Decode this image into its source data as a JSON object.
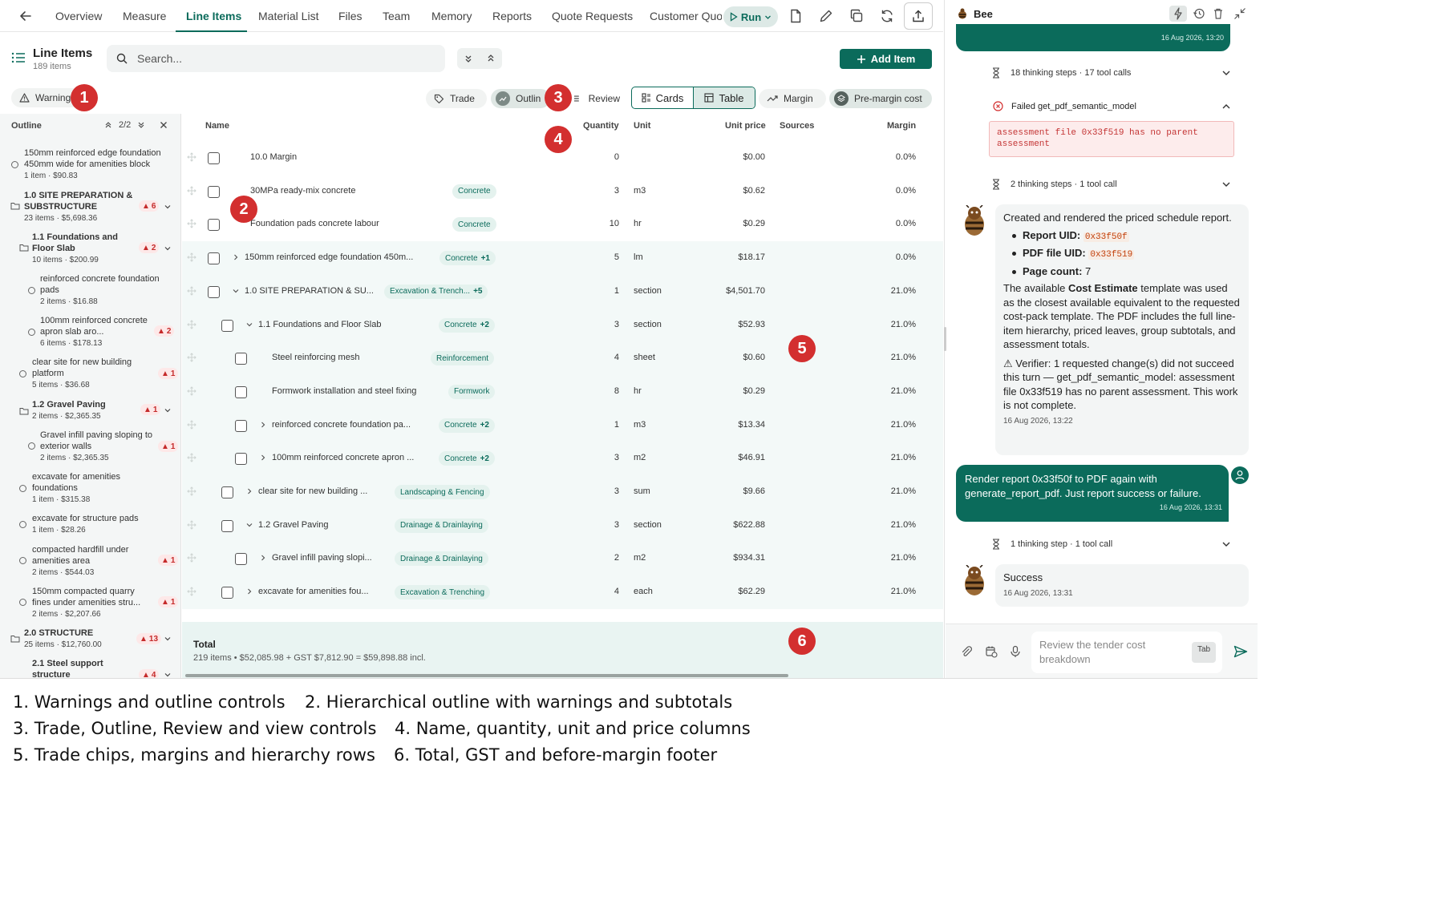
{
  "nav": {
    "tabs": [
      {
        "label": "Overview",
        "active": false
      },
      {
        "label": "Measure",
        "active": false
      },
      {
        "label": "Line Items",
        "active": true
      },
      {
        "label": "Material List",
        "active": false
      },
      {
        "label": "Files",
        "active": false
      },
      {
        "label": "Team",
        "active": false
      },
      {
        "label": "Memory",
        "active": false
      },
      {
        "label": "Reports",
        "active": false
      },
      {
        "label": "Quote Requests",
        "active": false
      },
      {
        "label": "Customer Quot",
        "active": false
      }
    ],
    "run_label": "Run",
    "accent": "#0b6b5b"
  },
  "header": {
    "title": "Line Items",
    "count": "189 items",
    "search_placeholder": "Search...",
    "add_label": "Add Item"
  },
  "filters": {
    "warnings": "Warning",
    "trade": "Trade",
    "outline": "Outlin",
    "review": "Review",
    "cards": "Cards",
    "table": "Table",
    "margin": "Margin",
    "premargin": "Pre-margin cost"
  },
  "outline": {
    "title": "Outline",
    "position": "2/2",
    "items": [
      {
        "name": "150mm reinforced edge foundation 450mm wide for amenities block",
        "meta": "1 item · $90.83"
      },
      {
        "name": "1.0 SITE PREPARATION & SUBSTRUCTURE",
        "meta": "23 items · $5,698.36",
        "warn": "6"
      },
      {
        "name": "1.1 Foundations and Floor Slab",
        "meta": "10 items · $200.99",
        "warn": "2"
      },
      {
        "name": "reinforced concrete foundation pads",
        "meta": "2 items · $16.88"
      },
      {
        "name": "100mm reinforced concrete apron slab aro...",
        "meta": "6 items · $178.13",
        "warn": "2"
      },
      {
        "name": "clear site for new building platform",
        "meta": "5 items · $36.68",
        "warn": "1"
      },
      {
        "name": "1.2 Gravel Paving",
        "meta": "2 items · $2,365.35",
        "warn": "1"
      },
      {
        "name": "Gravel infill paving sloping to exterior walls",
        "meta": "2 items · $2,365.35",
        "warn": "1"
      },
      {
        "name": "excavate for amenities foundations",
        "meta": "1 item · $315.38"
      },
      {
        "name": "excavate for structure pads",
        "meta": "1 item · $28.26"
      },
      {
        "name": "compacted hardfill under amenities area",
        "meta": "2 items · $544.03",
        "warn": "1"
      },
      {
        "name": "150mm compacted quarry fines under amenities stru...",
        "meta": "2 items · $2,207.66",
        "warn": "1"
      },
      {
        "name": "2.0 STRUCTURE",
        "meta": "25 items · $12,760.00",
        "warn": "13"
      },
      {
        "name": "2.1 Steel support structure",
        "meta": "",
        "warn": "4"
      }
    ]
  },
  "table": {
    "columns": {
      "name": "Name",
      "quantity": "Quantity",
      "unit": "Unit",
      "unit_price": "Unit price",
      "sources": "Sources",
      "margin": "Margin"
    },
    "rows": [
      {
        "name": "10.0 Margin",
        "trade": "",
        "extra": "",
        "qty": "0",
        "unit": "",
        "price": "$0.00",
        "margin": "0.0%"
      },
      {
        "name": "30MPa ready-mix concrete",
        "trade": "Concrete",
        "extra": "",
        "qty": "3",
        "unit": "m3",
        "price": "$0.62",
        "margin": "0.0%"
      },
      {
        "name": "Foundation pads concrete labour",
        "trade": "Concrete",
        "extra": "",
        "qty": "10",
        "unit": "hr",
        "price": "$0.29",
        "margin": "0.0%"
      },
      {
        "name": "150mm reinforced edge foundation 450m...",
        "trade": "Concrete",
        "extra": "+1",
        "qty": "5",
        "unit": "lm",
        "price": "$18.17",
        "margin": "0.0%"
      },
      {
        "name": "1.0 SITE PREPARATION & SU...",
        "trade": "Excavation & Trench...",
        "extra": "+5",
        "qty": "1",
        "unit": "section",
        "price": "$4,501.70",
        "margin": "21.0%"
      },
      {
        "name": "1.1 Foundations and Floor Slab",
        "trade": "Concrete",
        "extra": "+2",
        "qty": "3",
        "unit": "section",
        "price": "$52.93",
        "margin": "21.0%"
      },
      {
        "name": "Steel reinforcing mesh",
        "trade": "Reinforcement",
        "extra": "",
        "qty": "4",
        "unit": "sheet",
        "price": "$0.60",
        "margin": "21.0%"
      },
      {
        "name": "Formwork installation and steel fixing",
        "trade": "Formwork",
        "extra": "",
        "qty": "8",
        "unit": "hr",
        "price": "$0.29",
        "margin": "21.0%"
      },
      {
        "name": "reinforced concrete foundation pa...",
        "trade": "Concrete",
        "extra": "+2",
        "qty": "1",
        "unit": "m3",
        "price": "$13.34",
        "margin": "21.0%"
      },
      {
        "name": "100mm reinforced concrete apron ...",
        "trade": "Concrete",
        "extra": "+2",
        "qty": "3",
        "unit": "m2",
        "price": "$46.91",
        "margin": "21.0%"
      },
      {
        "name": "clear site for new building ...",
        "trade": "Landscaping & Fencing",
        "extra": "",
        "qty": "3",
        "unit": "sum",
        "price": "$9.66",
        "margin": "21.0%"
      },
      {
        "name": "1.2 Gravel Paving",
        "trade": "Drainage & Drainlaying",
        "extra": "",
        "qty": "3",
        "unit": "section",
        "price": "$622.88",
        "margin": "21.0%"
      },
      {
        "name": "Gravel infill paving slopi...",
        "trade": "Drainage & Drainlaying",
        "extra": "",
        "qty": "2",
        "unit": "m2",
        "price": "$934.31",
        "margin": "21.0%"
      },
      {
        "name": "excavate for amenities fou...",
        "trade": "Excavation & Trenching",
        "extra": "",
        "qty": "4",
        "unit": "each",
        "price": "$62.29",
        "margin": "21.0%"
      }
    ]
  },
  "footer": {
    "title": "Total",
    "summary": "219 items • $52,085.98 + GST $7,812.90 = $59,898.88 incl."
  },
  "chat": {
    "title": "Bee",
    "top_time": "16 Aug 2026, 13:20",
    "steps1": "18 thinking steps · 17 tool calls",
    "error_title": "Failed get_pdf_semantic_model",
    "error_text": "assessment file 0x33f519 has no parent assessment",
    "steps2": "2 thinking steps · 1 tool call",
    "msg1": {
      "intro": "Created and rendered the priced schedule report.",
      "report_label": "Report UID:",
      "report_uid": "0x33f50f",
      "pdf_label": "PDF file UID:",
      "pdf_uid": "0x33f519",
      "pages_label": "Page count:",
      "pages": "7",
      "p1_pre": "The available ",
      "p1_bold": "Cost Estimate",
      "p1_post": " template was used as the closest available equivalent to the requested cost-pack template. The PDF includes the full line-item hierarchy, priced leaves, group subtotals, and assessment totals.",
      "verifier": "⚠ Verifier: 1 requested change(s) did not succeed this turn — get_pdf_semantic_model: assessment file 0x33f519 has no parent assessment. This work is not complete.",
      "time": "16 Aug 2026, 13:22"
    },
    "user_msg": {
      "text": "Render report 0x33f50f to PDF again with generate_report_pdf. Just report success or failure.",
      "time": "16 Aug 2026, 13:31"
    },
    "steps3": "1 thinking step · 1 tool call",
    "msg2": {
      "text": "Success",
      "time": "16 Aug 2026, 13:31"
    },
    "composer_placeholder": "Review the tender cost breakdown",
    "tab_key": "Tab"
  },
  "markers": [
    "1",
    "2",
    "3",
    "4",
    "5",
    "6"
  ],
  "legend": [
    "1. Warnings and outline controls",
    "2. Hierarchical outline with warnings and subtotals",
    "3. Trade, Outline, Review and view controls",
    "4. Name, quantity, unit and price columns",
    "5. Trade chips, margins and hierarchy rows",
    "6. Total, GST and before-margin footer"
  ]
}
